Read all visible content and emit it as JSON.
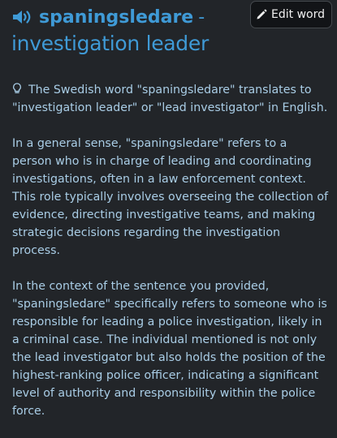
{
  "entry": {
    "word": "spaningsledare",
    "separator": "-",
    "translation": "investigation leader"
  },
  "toolbar": {
    "edit_label": "Edit word"
  },
  "icons": {
    "speaker": "speaker-icon",
    "edit": "pencil-icon",
    "hint": "lightbulb-icon"
  },
  "colors": {
    "background": "#222529",
    "accent": "#3f9ad6",
    "text": "#a9cde6"
  },
  "explanation": {
    "paragraphs": [
      "The Swedish word \"spaningsledare\" translates to \"investigation leader\" or \"lead investigator\" in English.",
      "In a general sense, \"spaningsledare\" refers to a person who is in charge of leading and coordinating investigations, often in a law enforcement context. This role typically involves overseeing the collection of evidence, directing investigative teams, and making strategic decisions regarding the investigation process.",
      "In the context of the sentence you provided, \"spaningsledare\" specifically refers to someone who is responsible for leading a police investigation, likely in a criminal case. The individual mentioned is not only the lead investigator but also holds the position of the highest-ranking police officer, indicating a significant level of authority and responsibility within the police force."
    ]
  }
}
